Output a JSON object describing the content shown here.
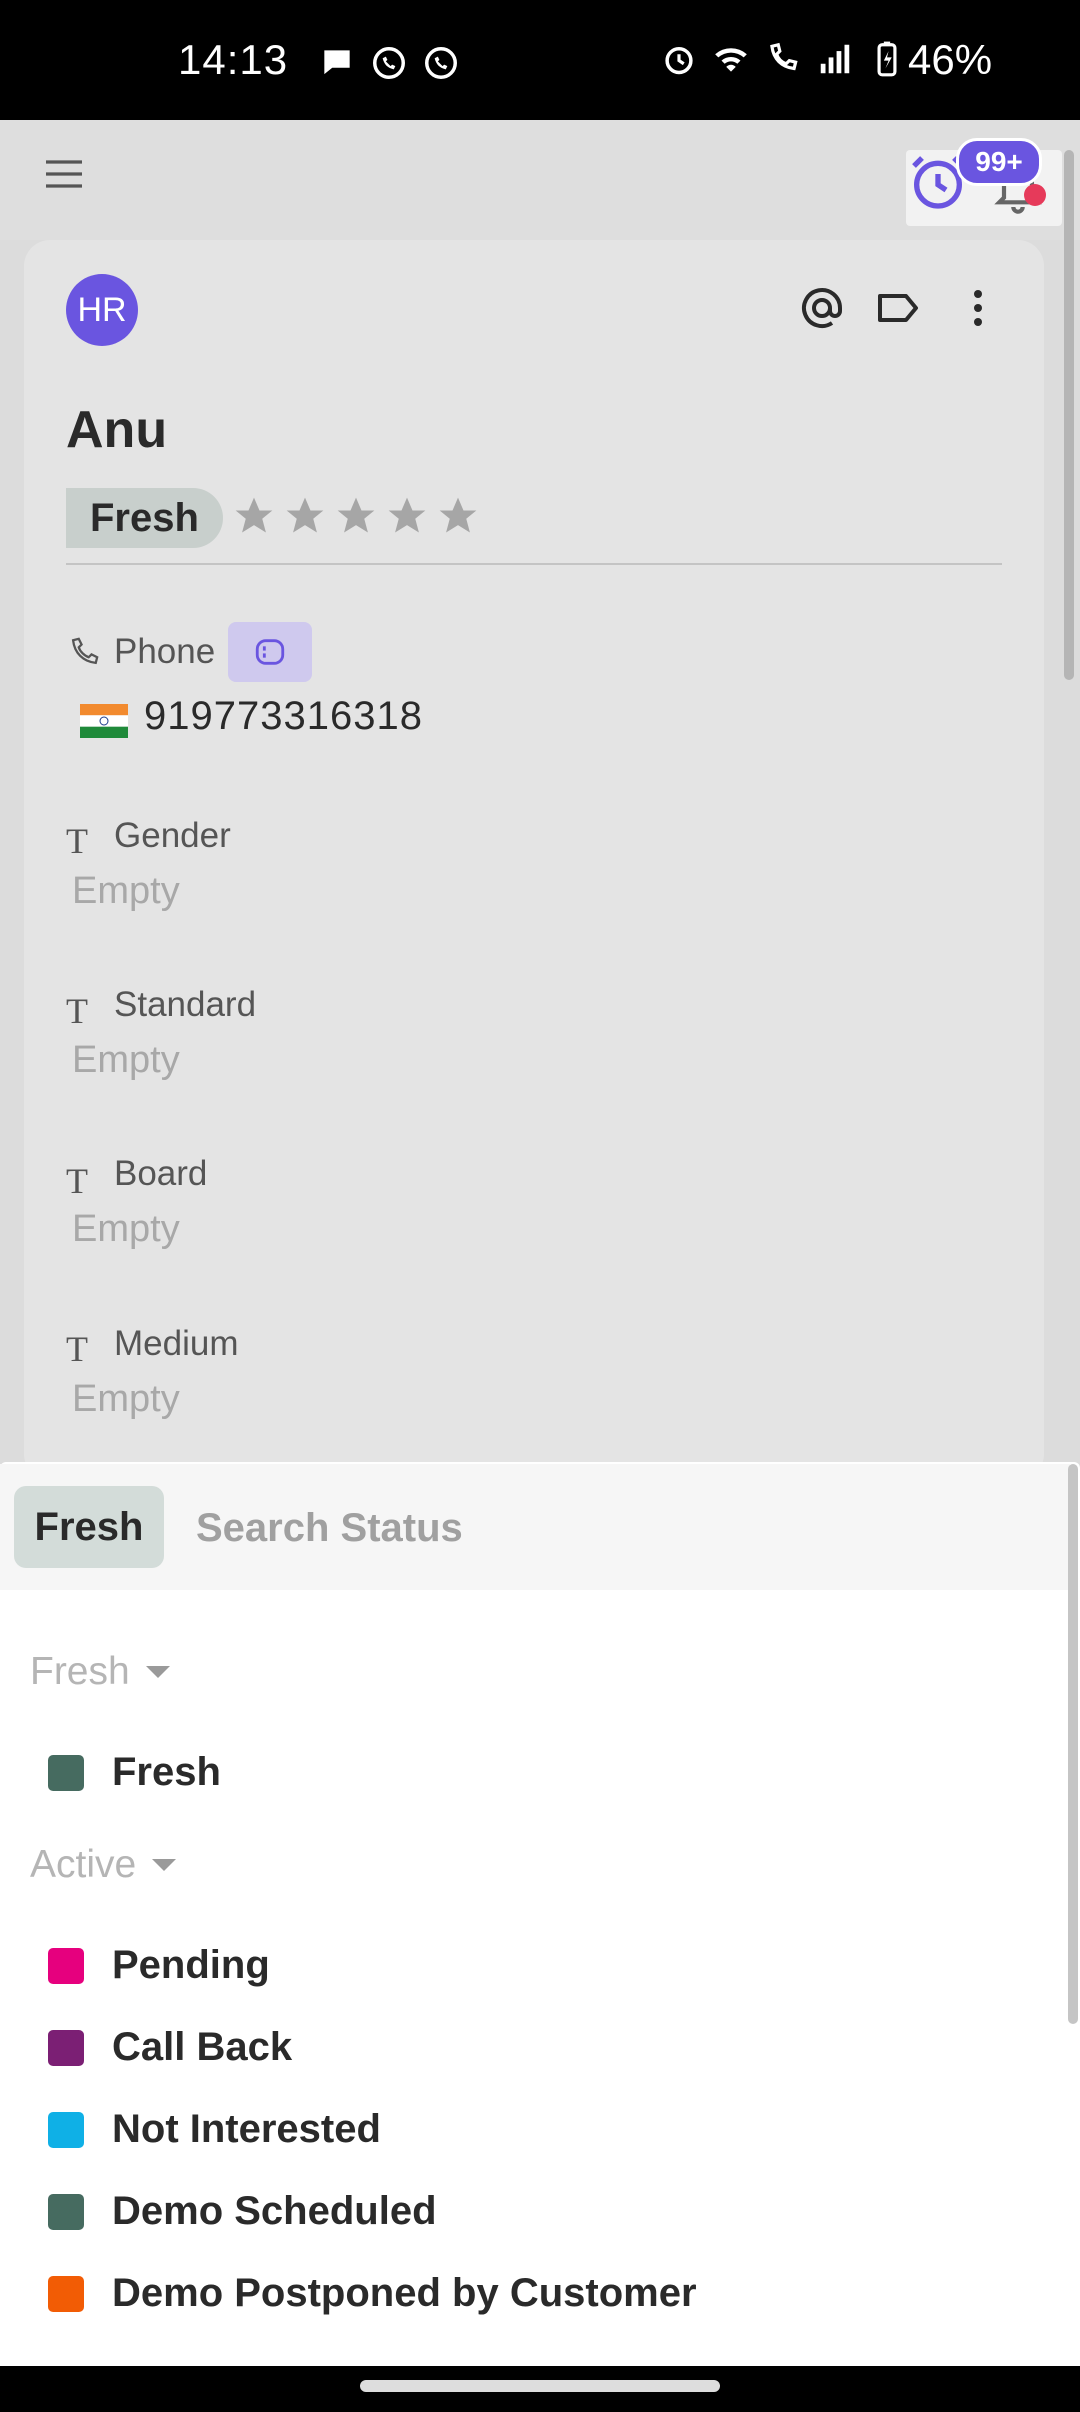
{
  "status_bar": {
    "time": "14:13",
    "battery": "46%",
    "left_icons": [
      "chat-bubble-icon",
      "whatsapp-icon",
      "voip-icon"
    ],
    "right_icons": [
      "alarm-icon",
      "wifi-icon",
      "call-icon",
      "signal-icon",
      "battery-charging-icon"
    ]
  },
  "app_bar": {
    "menu_icon": "hamburger-menu-icon",
    "notification_count": "99+",
    "reminder_icon": "alarm-clock-icon",
    "bell_icon": "bell-icon",
    "accent": "#6a55e0"
  },
  "contact": {
    "avatar_initials": "HR",
    "name": "Anu",
    "status": "Fresh",
    "rating_stars": 5,
    "rating_filled": 0,
    "actions": [
      "mention-icon",
      "tag-icon",
      "more-vert-icon"
    ],
    "phone": {
      "label": "Phone",
      "flag": "india-flag",
      "number": "919773316318"
    },
    "fields": [
      {
        "label": "Gender",
        "value": "Empty"
      },
      {
        "label": "Standard",
        "value": "Empty"
      },
      {
        "label": "Board",
        "value": "Empty"
      },
      {
        "label": "Medium",
        "value": "Empty"
      }
    ]
  },
  "status_picker": {
    "selected": "Fresh",
    "search_placeholder": "Search Status",
    "groups": [
      {
        "name": "Fresh",
        "options": [
          {
            "label": "Fresh",
            "color": "#466b60"
          }
        ]
      },
      {
        "name": "Active",
        "options": [
          {
            "label": "Pending",
            "color": "#e6007e"
          },
          {
            "label": "Call Back",
            "color": "#7b1f74"
          },
          {
            "label": "Not Interested",
            "color": "#0fb0e6"
          },
          {
            "label": "Demo Scheduled",
            "color": "#466b60"
          },
          {
            "label": "Demo Postponed by Customer",
            "color": "#f25c05"
          }
        ]
      }
    ]
  }
}
